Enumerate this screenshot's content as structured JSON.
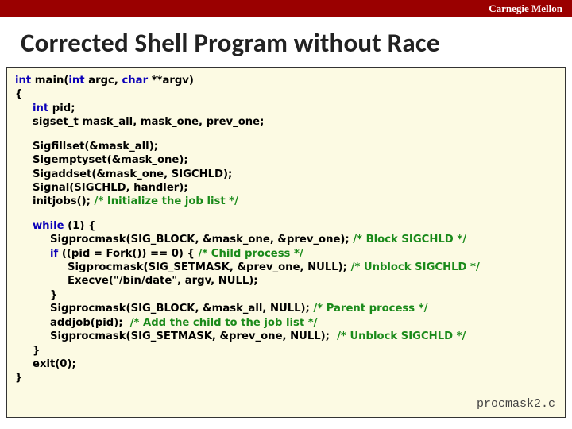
{
  "header": {
    "brand": "Carnegie Mellon"
  },
  "title": "Corrected Shell Program without Race",
  "code": {
    "l1a": "int",
    "l1b": " main(",
    "l1c": "int",
    "l1d": " argc, ",
    "l1e": "char",
    "l1f": " **argv)",
    "l2": "{",
    "l3a": "int",
    "l3b": " pid;",
    "l4": "sigset_t mask_all, mask_one, prev_one;",
    "l5": "Sigfillset(&mask_all);",
    "l6": "Sigemptyset(&mask_one);",
    "l7": "Sigaddset(&mask_one, SIGCHLD);",
    "l8": "Signal(SIGCHLD, handler);",
    "l9a": "initjobs(); ",
    "l9b": "/* Initialize the job list */",
    "l10a": "while",
    "l10b": " (1) {",
    "l11a": "Sigprocmask(SIG_BLOCK, &mask_one, &prev_one); ",
    "l11b": "/* Block SIGCHLD */",
    "l12a": "if",
    "l12b": " ((pid = Fork()) == 0) { ",
    "l12c": "/* Child process */",
    "l13a": "Sigprocmask(SIG_SETMASK, &prev_one, NULL); ",
    "l13b": "/* Unblock SIGCHLD */",
    "l14": "Execve(\"/bin/date\", argv, NULL);",
    "l15": "}",
    "l16a": "Sigprocmask(SIG_BLOCK, &mask_all, NULL); ",
    "l16b": "/* Parent process */",
    "l17a": "addjob(pid);  ",
    "l17b": "/* Add the child to the job list */",
    "l18a": "Sigprocmask(SIG_SETMASK, &prev_one, NULL);  ",
    "l18b": "/* Unblock SIGCHLD */",
    "l19": "}",
    "l20": "exit(0);",
    "l21": "}"
  },
  "filename": "procmask2.c"
}
